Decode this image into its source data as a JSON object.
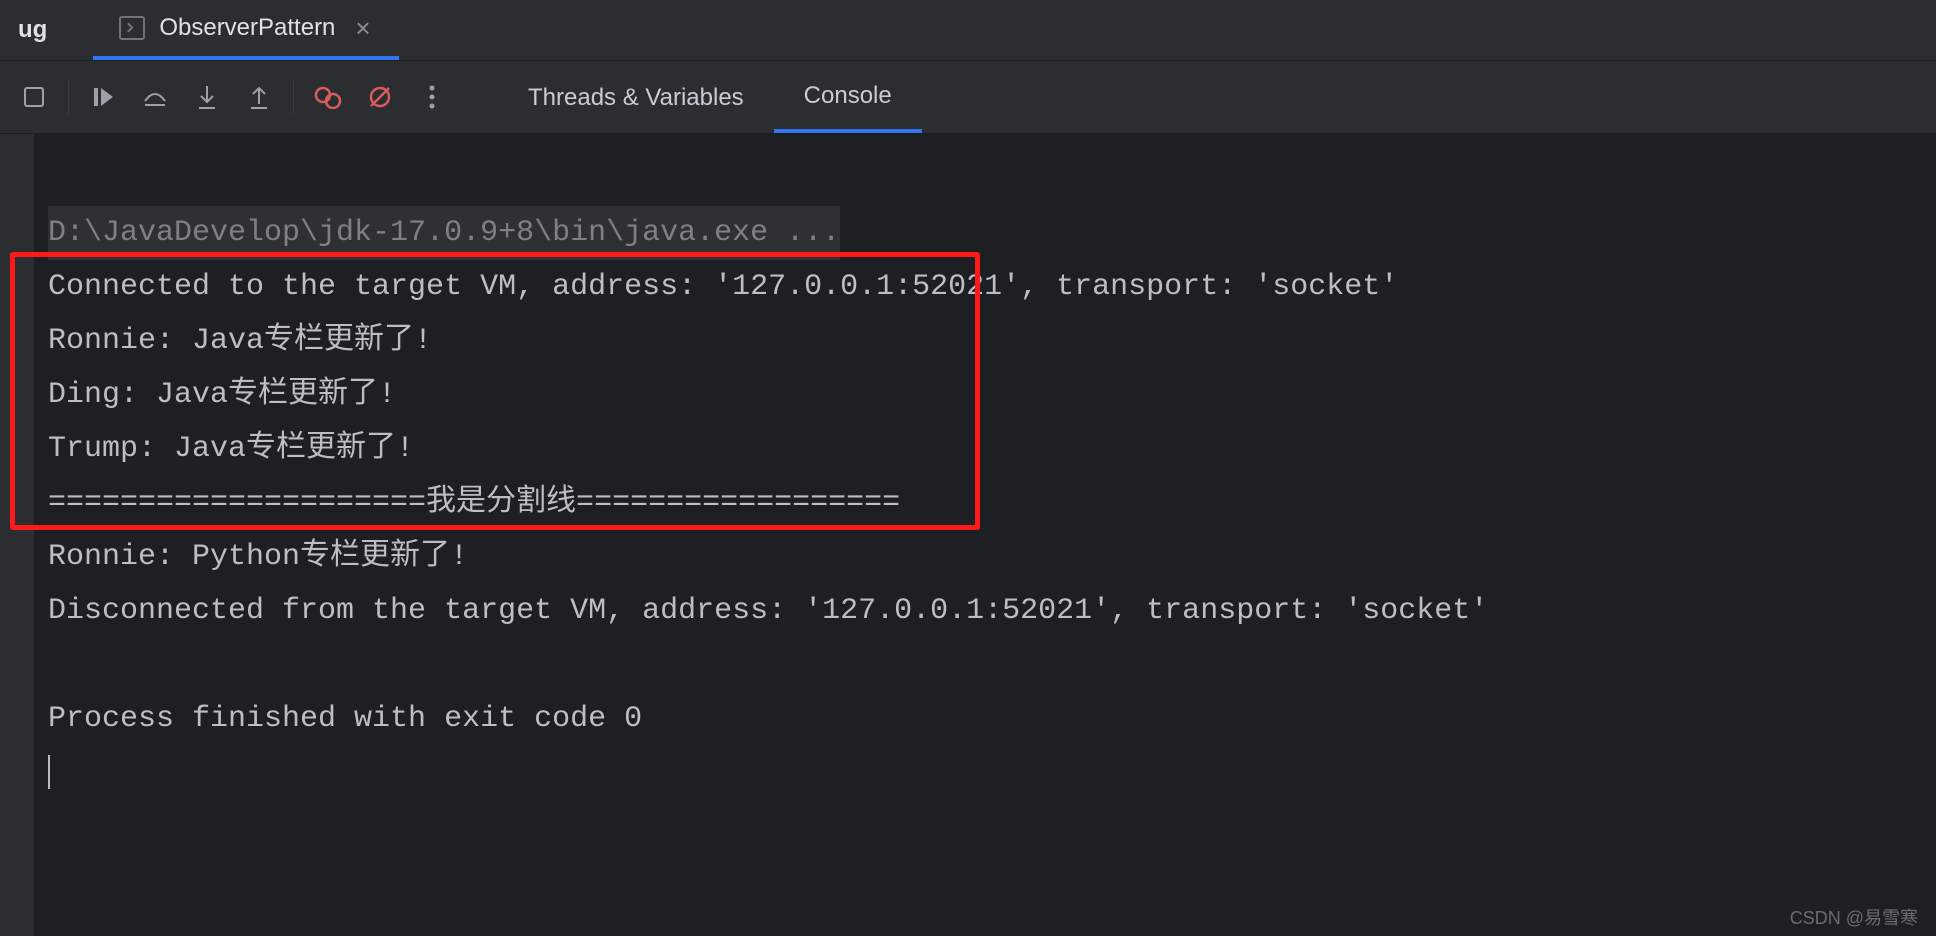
{
  "topbar": {
    "debug_label": "ug",
    "tab_label": "ObserverPattern"
  },
  "view_tabs": {
    "threads": "Threads & Variables",
    "console": "Console"
  },
  "console": {
    "cmd_line": "D:\\JavaDevelop\\jdk-17.0.9+8\\bin\\java.exe ...",
    "connected": "Connected to the target VM, address: '127.0.0.1:52021', transport: 'socket'",
    "lines": [
      "Ronnie: Java专栏更新了!",
      "Ding: Java专栏更新了!",
      "Trump: Java专栏更新了!",
      "=====================我是分割线==================",
      "Ronnie: Python专栏更新了!"
    ],
    "disconnected": "Disconnected from the target VM, address: '127.0.0.1:52021', transport: 'socket'",
    "exit": "Process finished with exit code 0"
  },
  "watermark": "CSDN @易雪寒"
}
